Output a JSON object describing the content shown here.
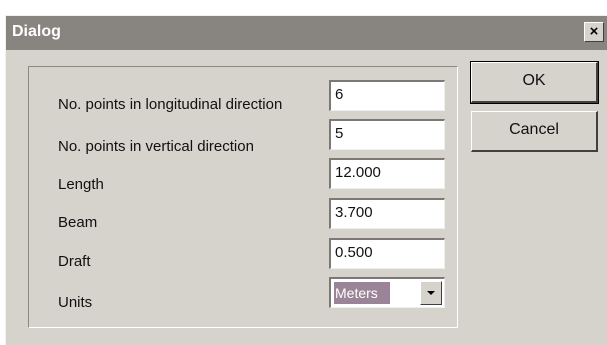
{
  "dialog": {
    "title": "Dialog",
    "close_label": "×"
  },
  "fields": {
    "longitudinal_points": {
      "label": "No. points in longitudinal direction",
      "value": "6"
    },
    "vertical_points": {
      "label": "No. points in vertical direction",
      "value": "5"
    },
    "length": {
      "label": "Length",
      "value": "12.000"
    },
    "beam": {
      "label": "Beam",
      "value": "3.700"
    },
    "draft": {
      "label": "Draft",
      "value": "0.500"
    },
    "units": {
      "label": "Units",
      "selected": "Meters",
      "icon": "chevron-down-icon"
    }
  },
  "buttons": {
    "ok_label": "OK",
    "cancel_label": "Cancel"
  },
  "colors": {
    "titlebar": "#888480",
    "dialog_bg": "#d6d2cc",
    "selection": "#9c8498"
  }
}
